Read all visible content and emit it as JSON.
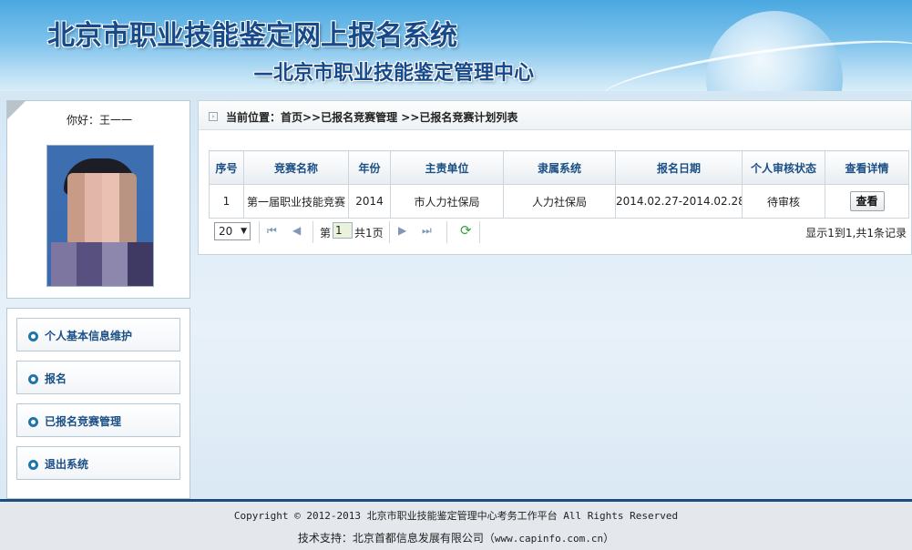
{
  "header": {
    "title": "北京市职业技能鉴定网上报名系统",
    "subtitle": "—北京市职业技能鉴定管理中心"
  },
  "user": {
    "greeting": "你好：王一一"
  },
  "sidebar": {
    "items": [
      {
        "label": "个人基本信息维护"
      },
      {
        "label": "报名"
      },
      {
        "label": "已报名竞赛管理"
      },
      {
        "label": "退出系统"
      }
    ]
  },
  "breadcrumb": {
    "text": "当前位置：首页>>已报名竞赛管理 >>已报名竞赛计划列表"
  },
  "table": {
    "headers": [
      "序号",
      "竞赛名称",
      "年份",
      "主责单位",
      "隶属系统",
      "报名日期",
      "个人审核状态",
      "查看详情"
    ],
    "rows": [
      {
        "index": "1",
        "name": "第一届职业技能竞赛",
        "year": "2014",
        "unit": "市人力社保局",
        "system": "人力社保局",
        "date": "2014.02.27-2014.02.28",
        "status": "待审核",
        "action": "查看"
      }
    ]
  },
  "pager": {
    "page_size": "20",
    "page_prefix": "第",
    "current_page": "1",
    "total_pages": "共1页",
    "summary": "显示1到1,共1条记录"
  },
  "footer": {
    "copyright": "Copyright © 2012-2013 北京市职业技能鉴定管理中心考务工作平台 All Rights Reserved",
    "support_prefix": "技术支持：北京首都信息发展有限公司（",
    "support_url": "www.capinfo.com.cn",
    "support_suffix": "）"
  }
}
